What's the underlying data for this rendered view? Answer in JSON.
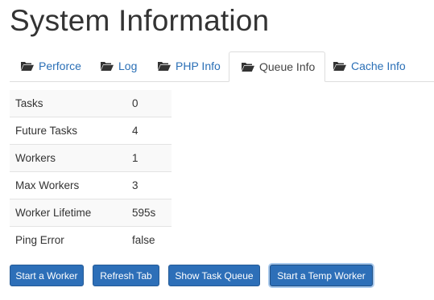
{
  "page_title": "System Information",
  "tabs": [
    {
      "label": "Perforce",
      "icon": "folder-open-icon",
      "active": false
    },
    {
      "label": "Log",
      "icon": "folder-open-icon",
      "active": false
    },
    {
      "label": "PHP Info",
      "icon": "folder-open-icon",
      "active": false
    },
    {
      "label": "Queue Info",
      "icon": "folder-open-icon",
      "active": true
    },
    {
      "label": "Cache Info",
      "icon": "folder-open-icon",
      "active": false
    }
  ],
  "queue_info": {
    "rows": [
      {
        "key": "Tasks",
        "value": "0"
      },
      {
        "key": "Future Tasks",
        "value": "4"
      },
      {
        "key": "Workers",
        "value": "1"
      },
      {
        "key": "Max Workers",
        "value": "3"
      },
      {
        "key": "Worker Lifetime",
        "value": "595s"
      },
      {
        "key": "Ping Error",
        "value": "false"
      }
    ]
  },
  "buttons": {
    "start_worker": "Start a Worker",
    "refresh_tab": "Refresh Tab",
    "show_task_queue": "Show Task Queue",
    "start_temp_worker": "Start a Temp Worker"
  },
  "colors": {
    "link": "#2a6fb6",
    "button_bg": "#2d6fb8",
    "button_focus_ring": "#a9c9ec",
    "table_stripe": "#f9f9f9"
  }
}
